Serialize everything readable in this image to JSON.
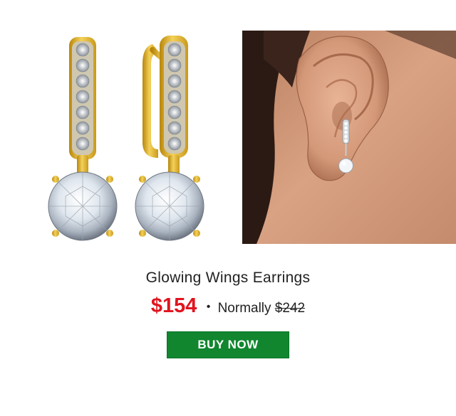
{
  "product": {
    "title": "Glowing Wings Earrings",
    "price": "$154",
    "bullet": "•",
    "normally_label": "Normally",
    "old_price": "$242"
  },
  "cta": {
    "label": "BUY NOW"
  },
  "images": {
    "product_photo": "earrings-product-photo",
    "model_photo": "earring-worn-on-ear-photo"
  },
  "colors": {
    "price": "#e0141e",
    "button": "#11862f",
    "gold": "#e3b62c"
  }
}
